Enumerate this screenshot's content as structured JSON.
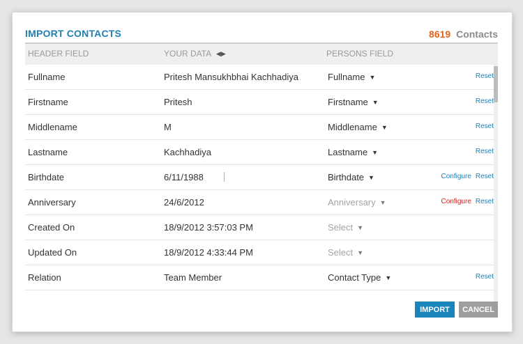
{
  "dialog": {
    "title": "IMPORT CONTACTS",
    "contact_count": "8619",
    "contact_label": "Contacts"
  },
  "table": {
    "headers": [
      "HEADER FIELD",
      "YOUR DATA",
      "PERSONS FIELD"
    ],
    "rows": [
      {
        "header": "Fullname",
        "data": "Pritesh Mansukhbhai Kachhadiya",
        "field": "Fullname",
        "reset": "Reset"
      },
      {
        "header": "Firstname",
        "data": "Pritesh",
        "field": "Firstname",
        "reset": "Reset"
      },
      {
        "header": "Middlename",
        "data": "M",
        "field": "Middlename",
        "reset": "Reset"
      },
      {
        "header": "Lastname",
        "data": "Kachhadiya",
        "field": "Lastname",
        "reset": "Reset"
      },
      {
        "header": "Birthdate",
        "data": "6/11/1988",
        "field": "Birthdate",
        "configure": "Configure",
        "reset": "Reset"
      },
      {
        "header": "Anniversary",
        "data": "24/6/2012",
        "field": "Anniversary",
        "configure": "Configure",
        "reset": "Reset"
      },
      {
        "header": "Created On",
        "data": "18/9/2012 3:57:03 PM",
        "field": "Select"
      },
      {
        "header": "Updated On",
        "data": "18/9/2012 4:33:44 PM",
        "field": "Select"
      },
      {
        "header": "Relation",
        "data": "Team Member",
        "field": "Contact Type",
        "reset": "Reset"
      }
    ]
  },
  "buttons": {
    "import": "IMPORT",
    "cancel": "CANCEL"
  },
  "colors": {
    "accent": "#1f7fb3",
    "count": "#e2631b",
    "warning_link": "#d61e1e",
    "cancel_button": "#9e9e9e"
  },
  "icons": {
    "sort": "left-right-arrows-icon",
    "dropdown": "caret-down-icon"
  }
}
